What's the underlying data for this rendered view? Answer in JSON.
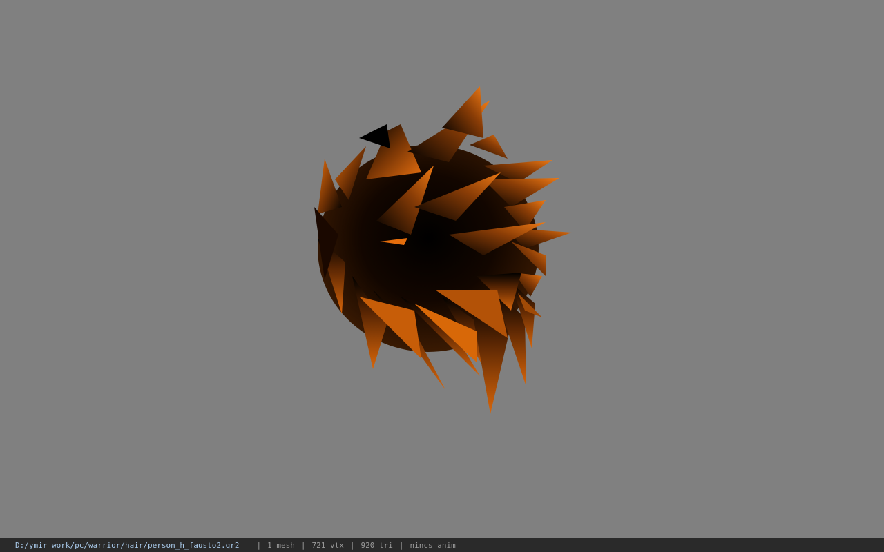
{
  "viewport": {
    "background_color": "#808080",
    "model_color": "#e46d0c",
    "model_shadow_color": "#000000"
  },
  "statusbar": {
    "file_path": "D:/ymir work/pc/warrior/hair/person_h_fausto2.gr2",
    "separator": "|",
    "mesh_count": "1 mesh",
    "vertex_count": "721 vtx",
    "triangle_count": "920 tri",
    "flags": "nincs anim"
  }
}
